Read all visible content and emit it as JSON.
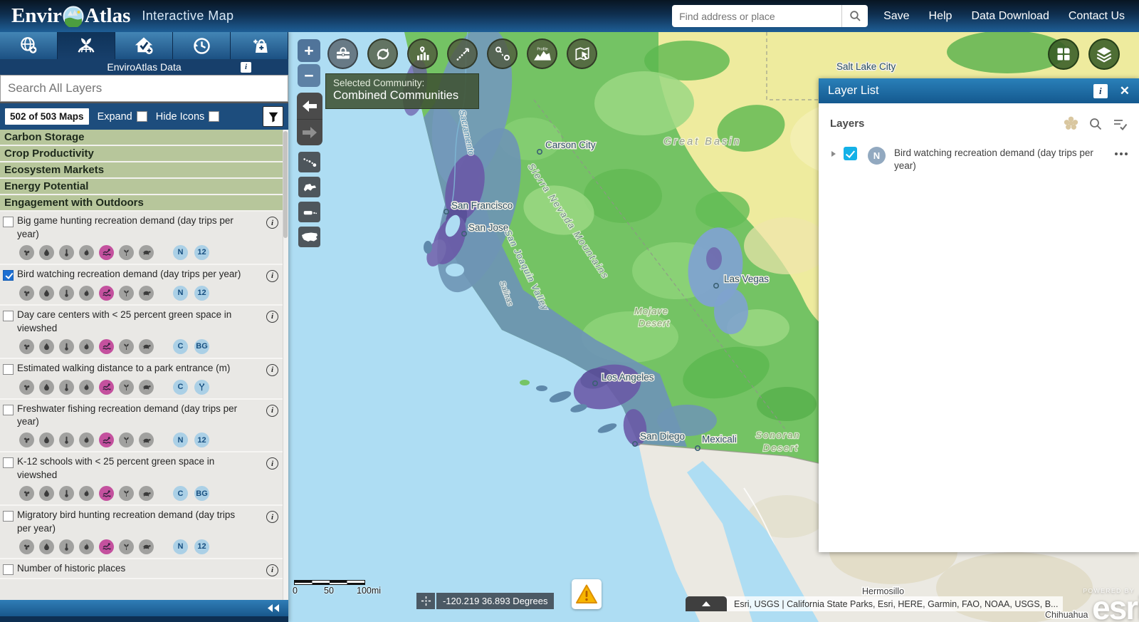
{
  "header": {
    "logo_prefix": "Envir",
    "logo_suffix": "Atlas",
    "subtitle": "Interactive Map",
    "search_placeholder": "Find address or place",
    "nav": [
      "Save",
      "Help",
      "Data Download",
      "Contact Us"
    ]
  },
  "sidebar": {
    "panel_title": "EnviroAtlas Data",
    "search_placeholder": "Search All Layers",
    "maps_count": "502 of 503 Maps",
    "expand_label": "Expand",
    "hide_icons_label": "Hide Icons",
    "categories": [
      "Carbon Storage",
      "Crop Productivity",
      "Ecosystem Markets",
      "Energy Potential",
      "Engagement with Outdoors"
    ],
    "eco_icons": [
      "air",
      "water",
      "temperature",
      "hazard",
      "recreation",
      "food",
      "wildlife"
    ],
    "layers": [
      {
        "label": "Big game hunting recreation demand (day trips per year)",
        "checked": false,
        "badges": [
          "N",
          "12"
        ],
        "show_icons": true
      },
      {
        "label": "Bird watching recreation demand (day trips per year)",
        "checked": true,
        "badges": [
          "N",
          "12"
        ],
        "show_icons": true
      },
      {
        "label": "Day care centers with < 25 percent green space in viewshed",
        "checked": false,
        "badges": [
          "C",
          "BG"
        ],
        "show_icons": true
      },
      {
        "label": "Estimated walking distance to a park entrance (m)",
        "checked": false,
        "badges": [
          "C",
          "fork"
        ],
        "show_icons": true
      },
      {
        "label": "Freshwater fishing recreation demand (day trips per year)",
        "checked": false,
        "badges": [
          "N",
          "12"
        ],
        "show_icons": true
      },
      {
        "label": "K-12 schools with < 25 percent green space in viewshed",
        "checked": false,
        "badges": [
          "C",
          "BG"
        ],
        "show_icons": true
      },
      {
        "label": "Migratory bird hunting recreation demand (day trips per year)",
        "checked": false,
        "badges": [
          "N",
          "12"
        ],
        "show_icons": true
      },
      {
        "label": "Number of historic places",
        "checked": false,
        "badges": [],
        "show_icons": false
      }
    ]
  },
  "map_toolbar": {
    "profile_label": "Profile"
  },
  "map": {
    "tooltip": {
      "title": "Selected Community:",
      "value": "Combined Communities"
    },
    "labels": {
      "salt_lake_city": "Salt Lake City",
      "carson_city": "Carson City",
      "great_basin": "Great Basin",
      "sacramento": "Sacramento",
      "san_francisco": "San Francisco",
      "san_jose": "San Jose",
      "sierra_nevada": "Sierra Nevada Mountains",
      "san_joaquin": "San Joaquin Valley",
      "salinas": "Salinas",
      "las_vegas": "Las Vegas",
      "mojave1": "Mojave",
      "mojave2": "Desert",
      "los_angeles": "Los Angeles",
      "san_diego": "San Diego",
      "mexicali": "Mexicali",
      "sonoran1": "Sonoran",
      "sonoran2": "Desert",
      "hermosillo": "Hermosillo",
      "chihuahua": "Chihuahua"
    },
    "scalebar": {
      "zero": "0",
      "fifty": "50",
      "hundred": "100mi"
    },
    "coordinates": "-120.219 36.893 Degrees",
    "attribution": "Esri, USGS | California State Parks, Esri, HERE, Garmin, FAO, NOAA, USGS, B...",
    "powered_by": "POWERED BY",
    "esri_logo": "esri"
  },
  "layer_list": {
    "title": "Layer List",
    "section": "Layers",
    "item": {
      "badge": "N",
      "label": "Bird watching recreation demand (day trips per year)"
    }
  },
  "colors": {
    "header_blue": "#1e5e96",
    "sidebar_navy": "#1d4d7d",
    "category_olive": "#b7c69b",
    "badge_blue": "#abd0e6",
    "recreation_pink": "#c4519e",
    "checkbox_cyan": "#14b1e7",
    "warning_orange": "#f7b500",
    "panel_header_blue": "#14598f"
  }
}
